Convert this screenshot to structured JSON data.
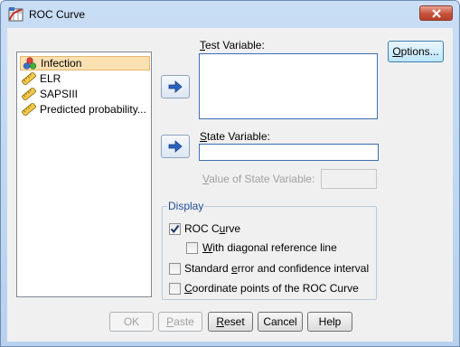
{
  "window": {
    "title": "ROC Curve"
  },
  "variables": [
    {
      "label": "Infection",
      "icon": "nominal-variable-icon",
      "selected": true
    },
    {
      "label": "ELR",
      "icon": "scale-variable-icon",
      "selected": false
    },
    {
      "label": "SAPSIII",
      "icon": "scale-variable-icon",
      "selected": false
    },
    {
      "label": "Predicted probability...",
      "icon": "scale-variable-icon",
      "selected": false
    }
  ],
  "test_variable": {
    "label_pre": "",
    "label_key": "T",
    "label_post": "est Variable:"
  },
  "state_variable": {
    "label_pre": "",
    "label_key": "S",
    "label_post": "tate Variable:"
  },
  "value_of_state": {
    "label_pre": "",
    "label_key": "V",
    "label_post": "alue of State Variable:"
  },
  "options_button": {
    "pre": "",
    "key": "O",
    "post": "ptions..."
  },
  "display": {
    "title": "Display",
    "roc_curve": {
      "pre": "ROC C",
      "key": "u",
      "post": "rve",
      "checked": true
    },
    "diagonal": {
      "pre": "",
      "key": "W",
      "post": "ith diagonal reference line",
      "checked": false
    },
    "std_error": {
      "pre": "Standard ",
      "key": "e",
      "post": "rror and confidence interval",
      "checked": false
    },
    "coords": {
      "pre": "",
      "key": "C",
      "post": "oordinate points of the ROC Curve",
      "checked": false
    }
  },
  "buttons": {
    "ok": "OK",
    "paste": {
      "pre": "",
      "key": "P",
      "post": "aste"
    },
    "reset": {
      "pre": "",
      "key": "R",
      "post": "eset"
    },
    "cancel": "Cancel",
    "help": "Help"
  },
  "colors": {
    "accent": "#3c6eb4",
    "selection": "#fbe1b2",
    "close": "#c7523b"
  }
}
